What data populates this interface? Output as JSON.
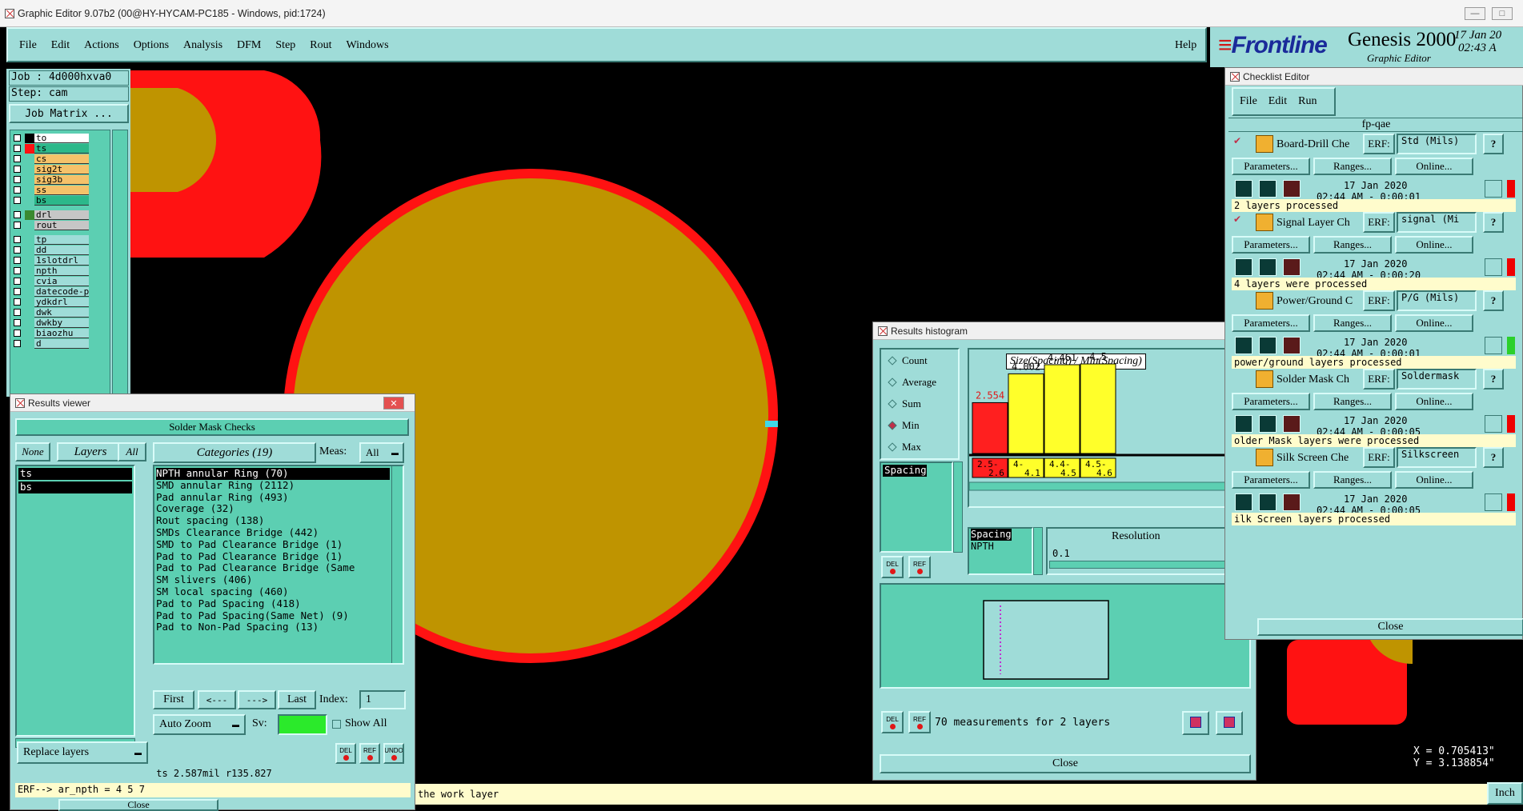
{
  "window": {
    "title": "Graphic Editor 9.07b2 (00@HY-HYCAM-PC185 - Windows, pid:1724)"
  },
  "menu": {
    "items": [
      "File",
      "Edit",
      "Actions",
      "Options",
      "Analysis",
      "DFM",
      "Step",
      "Rout",
      "Windows"
    ],
    "help": "Help"
  },
  "brand": {
    "logo": "Frontline",
    "product": "Genesis 2000",
    "subtitle": "Graphic Editor",
    "date": "17 Jan 20",
    "time": "02:43 A"
  },
  "job": {
    "job": "Job : 4d000hxva0",
    "step": "Step: cam",
    "matrix_button": "Job Matrix ..."
  },
  "layers": [
    {
      "name": "to",
      "color": "#ffffff"
    },
    {
      "name": "ts",
      "color": "#2cb88a"
    },
    {
      "name": "cs",
      "color": "#f5c26a"
    },
    {
      "name": "sig2t",
      "color": "#f5c26a"
    },
    {
      "name": "sig3b",
      "color": "#f5c26a"
    },
    {
      "name": "ss",
      "color": "#f5c26a"
    },
    {
      "name": "bs",
      "color": "#2cb88a"
    },
    {
      "name": "drl",
      "color": "#c6c6c6"
    },
    {
      "name": "rout",
      "color": "#c6c6c6"
    },
    {
      "name": "tp",
      "color": "#9fdcd8"
    },
    {
      "name": "dd",
      "color": "#9fdcd8"
    },
    {
      "name": "1slotdrl",
      "color": "#9fdcd8"
    },
    {
      "name": "npth",
      "color": "#9fdcd8"
    },
    {
      "name": "cvia",
      "color": "#9fdcd8"
    },
    {
      "name": "datecode-pte",
      "color": "#9fdcd8"
    },
    {
      "name": "ydkdrl",
      "color": "#9fdcd8"
    },
    {
      "name": "dwk",
      "color": "#9fdcd8"
    },
    {
      "name": "dwkby",
      "color": "#9fdcd8"
    },
    {
      "name": "biaozhu",
      "color": "#9fdcd8"
    },
    {
      "name": "d",
      "color": "#9fdcd8"
    }
  ],
  "results_viewer": {
    "title": "Results viewer",
    "header": "Solder Mask Checks",
    "tabs": {
      "none": "None",
      "layers": "Layers",
      "all": "All"
    },
    "categories_btn": "Categories (19)",
    "meas_label": "Meas:",
    "meas_value": "All",
    "layer_list": [
      "ts",
      "bs"
    ],
    "categories": [
      "NPTH annular Ring (70)",
      "SMD annular Ring (2112)",
      "Pad annular Ring (493)",
      "Coverage (32)",
      "Rout spacing (138)",
      "SMDs Clearance Bridge (442)",
      "SMD to Pad Clearance Bridge (1)",
      "Pad to Pad Clearance Bridge (1)",
      "Pad to Pad Clearance Bridge (Same",
      "SM slivers (406)",
      "SM local spacing (460)",
      "Pad to Pad Spacing (418)",
      "Pad to Pad Spacing(Same Net) (9)",
      "Pad to Non-Pad Spacing (13)"
    ],
    "nav": {
      "first": "First",
      "prev": "<---",
      "next": "--->",
      "last": "Last",
      "index_label": "Index:",
      "index_value": "1"
    },
    "zoom": "Auto Zoom",
    "sv_label": "Sv:",
    "show_all": "Show All",
    "replace": "Replace layers",
    "small_btns": [
      "DEL",
      "REF",
      "UNDO"
    ],
    "status": "ts  2.587mil  r135.827",
    "erf": "ERF--> ar_npth = 4 5 7",
    "close": "Close"
  },
  "message_bar": {
    "text": "the work layer",
    "unit": "Inch"
  },
  "coords": {
    "x": "X = 0.705413\"",
    "y": "Y = 3.138854\""
  },
  "histogram": {
    "title": "Results histogram",
    "modes": [
      {
        "label": "Count",
        "on": false
      },
      {
        "label": "Average",
        "on": false
      },
      {
        "label": "Sum",
        "on": false
      },
      {
        "label": "Min",
        "on": true
      },
      {
        "label": "Max",
        "on": false
      }
    ],
    "measure_list": [
      "Spacing"
    ],
    "chart_title": "Size(Spacing) / Min(Spacing)",
    "bars": [
      {
        "range": "2.5-\n2.6",
        "value": 2.554,
        "label": "2.554",
        "color": "#ff1f1f"
      },
      {
        "range": "4-\n4.1",
        "value": 4.002,
        "label": "4.002",
        "color": "#ffff2a"
      },
      {
        "range": "4.4-\n4.5",
        "value": 4.461,
        "label": "4.461",
        "color": "#ffff2a"
      },
      {
        "range": "4.5-\n4.6",
        "value": 4.5,
        "label": "4.5",
        "color": "#ffff2a"
      }
    ],
    "sel_list": [
      "Spacing",
      "NPTH"
    ],
    "resolution_label": "Resolution",
    "resolution_value": "0.1",
    "small_btns": [
      "DEL",
      "REF"
    ],
    "summary": "70 measurements for 2 layers",
    "close": "Close"
  },
  "checklist": {
    "title": "Checklist Editor",
    "menu": [
      "File",
      "Edit",
      "Run"
    ],
    "name": "fp-qae",
    "erf_label": "ERF:",
    "param_btn": "Parameters...",
    "ranges_btn": "Ranges...",
    "online_btn": "Online...",
    "items": [
      {
        "name": "Board-Drill Che",
        "erf": "Std (Mils)",
        "date": "17 Jan 2020",
        "time": "02:44 AM - 0:00:01",
        "msg": "2 layers processed",
        "status": "red",
        "checked": true
      },
      {
        "name": "Signal Layer Ch",
        "erf": "signal (Mi",
        "date": "17 Jan 2020",
        "time": "02:44 AM - 0:00:20",
        "msg": "4 layers were processed",
        "status": "red",
        "checked": true
      },
      {
        "name": "Power/Ground C",
        "erf": "P/G (Mils)",
        "date": "17 Jan 2020",
        "time": "02:44 AM - 0:00:01",
        "msg": "power/ground layers processed",
        "status": "green",
        "checked": false
      },
      {
        "name": "Solder Mask Ch",
        "erf": "Soldermask",
        "date": "17 Jan 2020",
        "time": "02:44 AM - 0:00:05",
        "msg": "older Mask layers were processed",
        "status": "red",
        "checked": false
      },
      {
        "name": "Silk Screen Che",
        "erf": "Silkscreen",
        "date": "17 Jan 2020",
        "time": "02:44 AM - 0:00:05",
        "msg": "ilk Screen layers processed",
        "status": "red",
        "checked": false
      }
    ],
    "close": "Close"
  }
}
